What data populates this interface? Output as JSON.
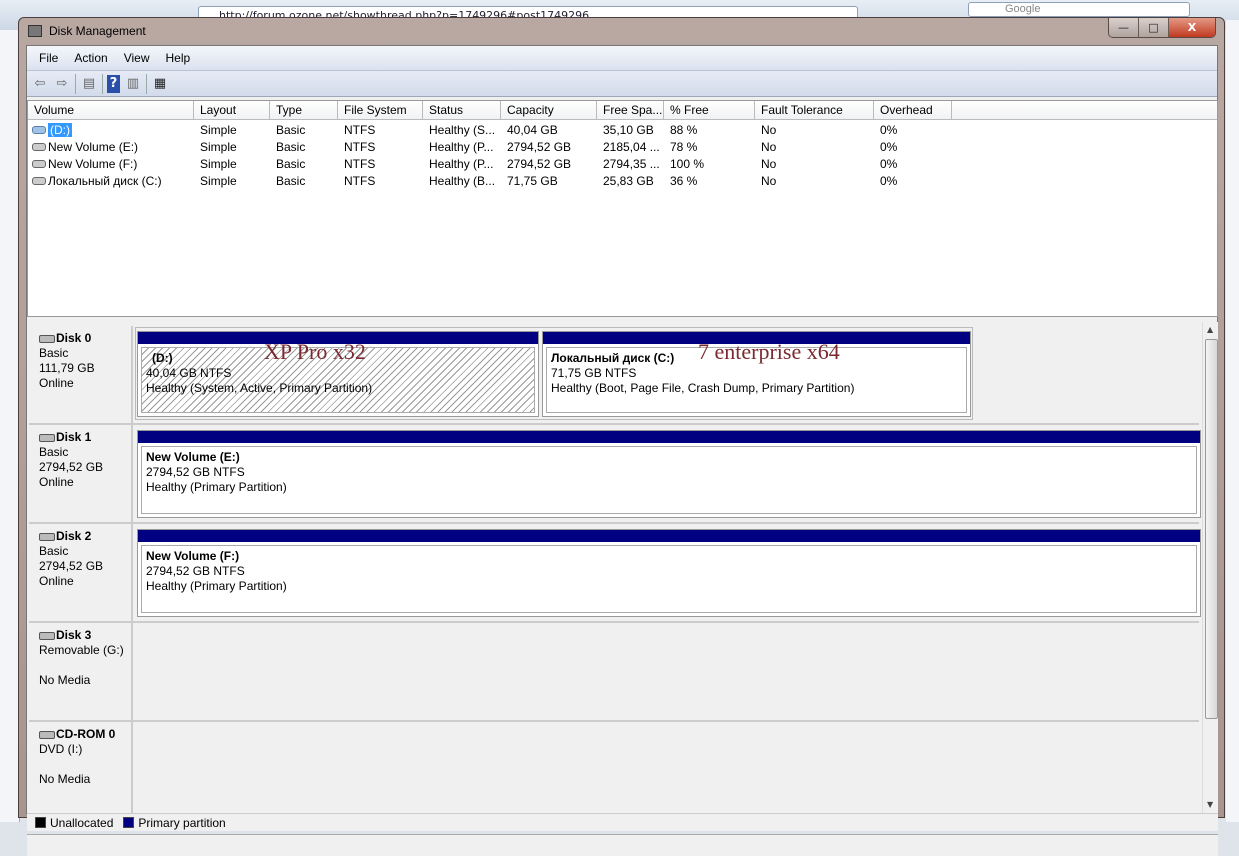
{
  "background": {
    "url": "http://forum.ozone.net/showthread.php?p=1749296#post1749296",
    "search": "Google"
  },
  "window": {
    "title": "Disk Management",
    "minimize": "—",
    "maximize": "□",
    "close": "X"
  },
  "menu": [
    "File",
    "Action",
    "View",
    "Help"
  ],
  "toolbar": {
    "icons": [
      "back-icon",
      "forward-icon",
      "show-hide-console-tree-icon",
      "help-icon",
      "show-hide-action-pane-icon",
      "properties-icon"
    ]
  },
  "volumes": {
    "columns": [
      "Volume",
      "Layout",
      "Type",
      "File System",
      "Status",
      "Capacity",
      "Free Spa...",
      "% Free",
      "Fault Tolerance",
      "Overhead"
    ],
    "rows": [
      [
        "(D:)",
        "Simple",
        "Basic",
        "NTFS",
        "Healthy (S...",
        "40,04 GB",
        "35,10 GB",
        "88 %",
        "No",
        "0%"
      ],
      [
        "New Volume (E:)",
        "Simple",
        "Basic",
        "NTFS",
        "Healthy (P...",
        "2794,52 GB",
        "2185,04 ...",
        "78 %",
        "No",
        "0%"
      ],
      [
        "New Volume (F:)",
        "Simple",
        "Basic",
        "NTFS",
        "Healthy (P...",
        "2794,52 GB",
        "2794,35 ...",
        "100 %",
        "No",
        "0%"
      ],
      [
        "Локальный диск (C:)",
        "Simple",
        "Basic",
        "NTFS",
        "Healthy (B...",
        "71,75 GB",
        "25,83 GB",
        "36 %",
        "No",
        "0%"
      ]
    ]
  },
  "disks": [
    {
      "name": "Disk 0",
      "type": "Basic",
      "size": "111,79 GB",
      "state": "Online",
      "partitions": [
        {
          "name": "(D:)",
          "size": "40,04 GB NTFS",
          "status": "Healthy (System, Active, Primary Partition)",
          "annotation": "XP Pro x32"
        },
        {
          "name": "Локальный диск  (C:)",
          "size": "71,75 GB NTFS",
          "status": "Healthy (Boot, Page File, Crash Dump, Primary Partition)",
          "annotation": "7 enterprise x64"
        }
      ]
    },
    {
      "name": "Disk 1",
      "type": "Basic",
      "size": "2794,52 GB",
      "state": "Online",
      "partitions": [
        {
          "name": "New Volume  (E:)",
          "size": "2794,52 GB NTFS",
          "status": "Healthy (Primary Partition)"
        }
      ]
    },
    {
      "name": "Disk 2",
      "type": "Basic",
      "size": "2794,52 GB",
      "state": "Online",
      "partitions": [
        {
          "name": "New Volume  (F:)",
          "size": "2794,52 GB NTFS",
          "status": "Healthy (Primary Partition)"
        }
      ]
    },
    {
      "name": "Disk 3",
      "type": "Removable (G:)",
      "state": "No Media"
    },
    {
      "name": "CD-ROM 0",
      "type": "DVD (I:)",
      "state": "No Media"
    }
  ],
  "legend": [
    {
      "label": "Unallocated",
      "color": "#000000"
    },
    {
      "label": "Primary partition",
      "color": "#000080"
    }
  ]
}
